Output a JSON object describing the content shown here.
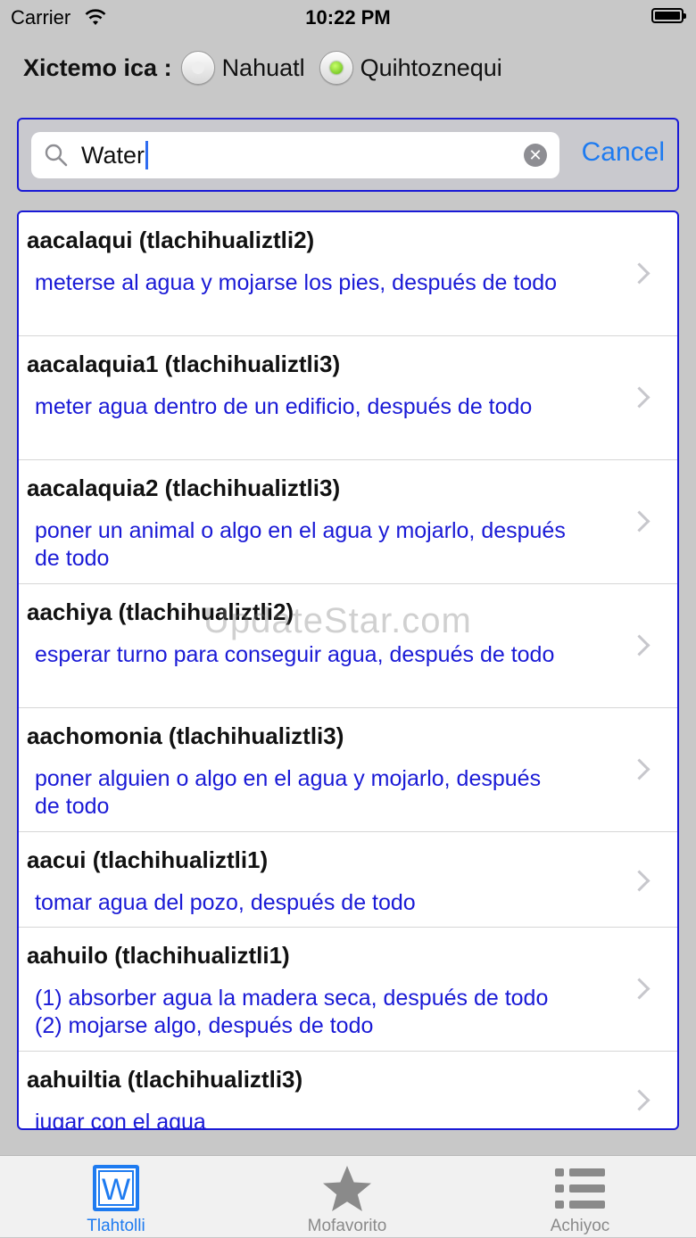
{
  "status": {
    "carrier": "Carrier",
    "time": "10:22 PM"
  },
  "lang": {
    "label": "Xictemo ica :",
    "options": [
      "Nahuatl",
      "Quihtoznequi"
    ],
    "selected": "Quihtoznequi"
  },
  "search": {
    "value": "Water",
    "cancel": "Cancel"
  },
  "results": [
    {
      "term": "aacalaqui (tlachihualiztli2)",
      "definition": "meterse al agua y mojarse los pies, después de todo"
    },
    {
      "term": "aacalaquia1 (tlachihualiztli3)",
      "definition": "meter agua dentro de un edificio, después de todo"
    },
    {
      "term": "aacalaquia2 (tlachihualiztli3)",
      "definition": "poner un animal o algo en el agua y mojarlo, después de todo"
    },
    {
      "term": "aachiya (tlachihualiztli2)",
      "definition": "esperar turno para conseguir agua, después de todo"
    },
    {
      "term": "aachomonia (tlachihualiztli3)",
      "definition": "poner alguien o algo en el agua y mojarlo, después de todo"
    },
    {
      "term": "aacui (tlachihualiztli1)",
      "definition": "tomar agua del pozo, después de todo"
    },
    {
      "term": "aahuilo (tlachihualiztli1)",
      "definition": "(1) absorber agua la madera seca, después de todo (2) mojarse algo, después de todo"
    },
    {
      "term": "aahuiltia (tlachihualiztli3)",
      "definition": "jugar con el agua"
    }
  ],
  "watermark": "UpdateStar.com",
  "tabs": [
    {
      "label": "Tlahtolli",
      "icon": "word-document-icon",
      "active": true
    },
    {
      "label": "Mofavorito",
      "icon": "star-icon",
      "active": false
    },
    {
      "label": "Achiyoc",
      "icon": "list-icon",
      "active": false
    }
  ],
  "colors": {
    "accent": "#1e7bf0",
    "definition": "#1a1ad6",
    "frame": "#1a1ad6"
  }
}
